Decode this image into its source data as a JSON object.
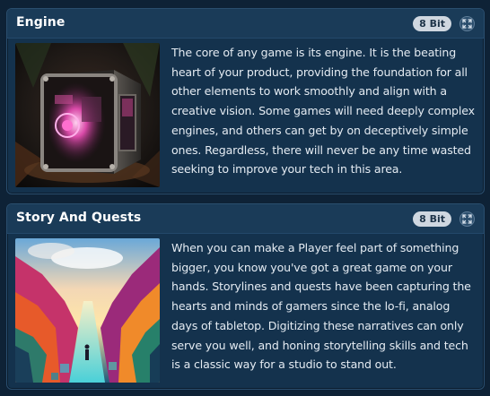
{
  "cards": [
    {
      "title": "Engine",
      "badge": "8 Bit",
      "image_icon": "engine-artwork",
      "description": "The core of any game is its engine. It is the beating heart of your product, providing the foundation for all other elements to work smoothly and align with a creative vision. Some games will need deeply complex engines, and others can get by on deceptively simple ones. Regardless, there will never be any time wasted seeking to improve your tech in this area."
    },
    {
      "title": "Story And Quests",
      "badge": "8 Bit",
      "image_icon": "story-artwork",
      "description": "When you can make a Player feel part of something bigger, you know you've got a great game on your hands. Storylines and quests have been capturing the hearts and minds of gamers since the lo-fi, analog days of tabletop. Digitizing these narratives can only serve you well, and honing storytelling skills and tech is a classic way for a studio to stand out."
    }
  ],
  "colors": {
    "background": "#0e2236",
    "card": "#14324d",
    "badge": "#cfd7e0"
  }
}
